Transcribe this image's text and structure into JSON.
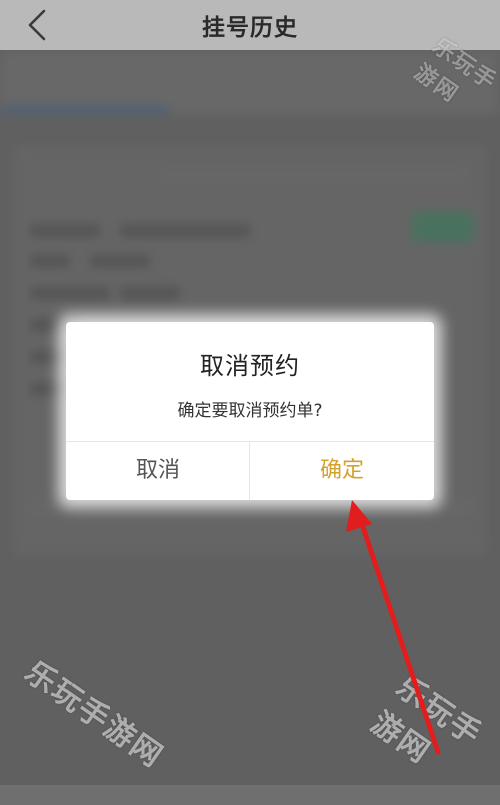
{
  "header": {
    "title": "挂号历史"
  },
  "background_page": {
    "tabs": [
      "",
      "",
      ""
    ]
  },
  "dialog": {
    "title": "取消预约",
    "message": "确定要取消预约单?",
    "cancel_label": "取消",
    "confirm_label": "确定"
  },
  "annotation": {
    "arrow_color": "#e11d1d"
  },
  "watermark": {
    "text": "乐玩手游网"
  },
  "colors": {
    "confirm_text": "#d4a12d",
    "accent_tab": "#3f6aa3",
    "green_button": "#4c8a6c"
  }
}
